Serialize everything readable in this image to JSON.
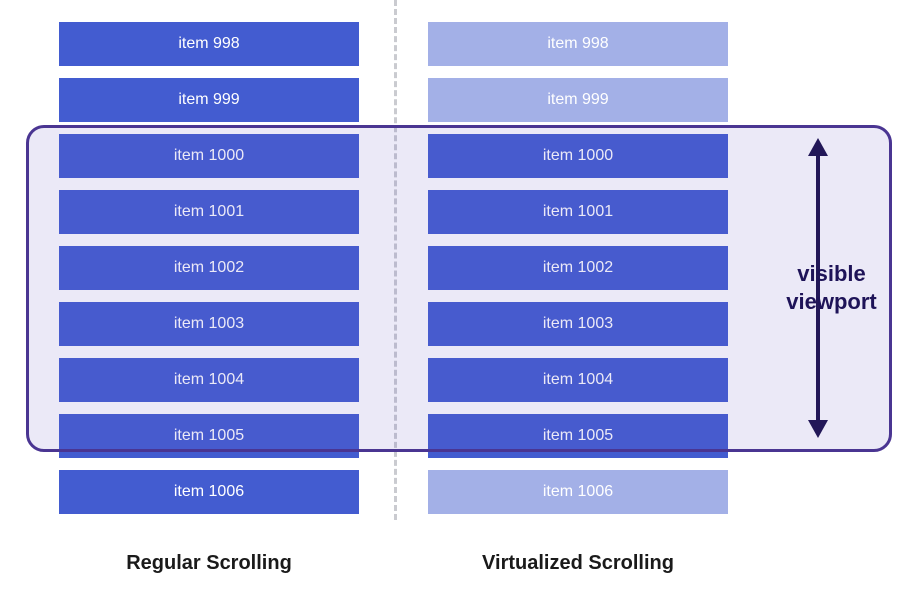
{
  "left_column": {
    "items": [
      {
        "label": "item 998",
        "style": "solid"
      },
      {
        "label": "item 999",
        "style": "solid"
      },
      {
        "label": "item 1000",
        "style": "solid"
      },
      {
        "label": "item 1001",
        "style": "solid"
      },
      {
        "label": "item 1002",
        "style": "solid"
      },
      {
        "label": "item 1003",
        "style": "solid"
      },
      {
        "label": "item 1004",
        "style": "solid"
      },
      {
        "label": "item 1005",
        "style": "solid"
      },
      {
        "label": "item 1006",
        "style": "solid"
      }
    ],
    "caption": "Regular Scrolling"
  },
  "right_column": {
    "items": [
      {
        "label": "item 998",
        "style": "faded"
      },
      {
        "label": "item 999",
        "style": "faded"
      },
      {
        "label": "item 1000",
        "style": "solid"
      },
      {
        "label": "item 1001",
        "style": "solid"
      },
      {
        "label": "item 1002",
        "style": "solid"
      },
      {
        "label": "item 1003",
        "style": "solid"
      },
      {
        "label": "item 1004",
        "style": "solid"
      },
      {
        "label": "item 1005",
        "style": "solid"
      },
      {
        "label": "item 1006",
        "style": "faded"
      }
    ],
    "caption": "Virtualized Scrolling"
  },
  "viewport_label_line1": "visible",
  "viewport_label_line2": "viewport",
  "colors": {
    "item_solid": "#435cd0",
    "item_faded": "#a3b0e7",
    "viewport_border": "#4a3592",
    "viewport_fill": "rgba(103,83,190,0.13)",
    "divider": "#cacbd0",
    "arrow": "#221758"
  }
}
